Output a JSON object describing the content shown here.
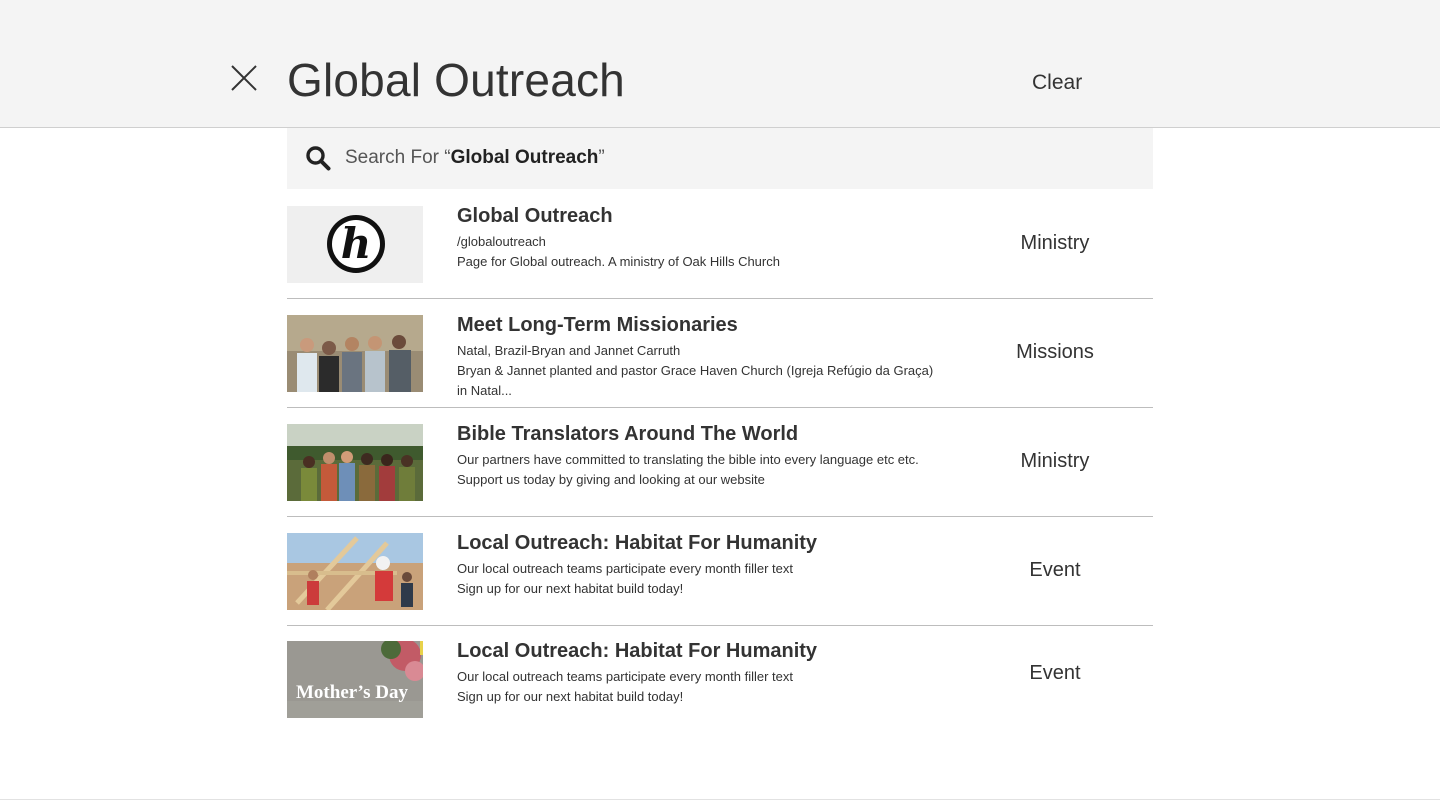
{
  "header": {
    "query": "Global Outreach",
    "clear_label": "Clear"
  },
  "search_for": {
    "prefix": "Search For “",
    "term": "Global Outreach",
    "suffix": "”"
  },
  "results": [
    {
      "title": "Global Outreach",
      "lines": [
        "/globaloutreach",
        "Page for Global outreach. A ministry of Oak Hills Church"
      ],
      "category": "Ministry",
      "thumb": "logo"
    },
    {
      "title": "Meet Long-Term Missionaries",
      "lines": [
        "Natal, Brazil-Bryan and Jannet Carruth",
        "Bryan & Jannet planted and pastor Grace Haven Church (Igreja Refúgio da Graça) in Natal..."
      ],
      "category": "Missions",
      "thumb": "photo-group"
    },
    {
      "title": "Bible Translators Around The World",
      "lines": [
        "Our partners have committed to translating the bible into every language etc etc.",
        "Support us today by giving and looking at our website"
      ],
      "category": "Ministry",
      "thumb": "photo-village"
    },
    {
      "title": "Local Outreach: Habitat For Humanity",
      "lines": [
        "Our local outreach teams participate every month filler text",
        "Sign up for our next habitat build today!"
      ],
      "category": "Event",
      "thumb": "photo-build"
    },
    {
      "title": "Local Outreach: Habitat For Humanity",
      "lines": [
        "Our local outreach teams participate every month filler text",
        "Sign up for our next habitat build today!"
      ],
      "category": "Event",
      "thumb": "mothers-day",
      "thumb_text": "Mother’s Day"
    }
  ]
}
